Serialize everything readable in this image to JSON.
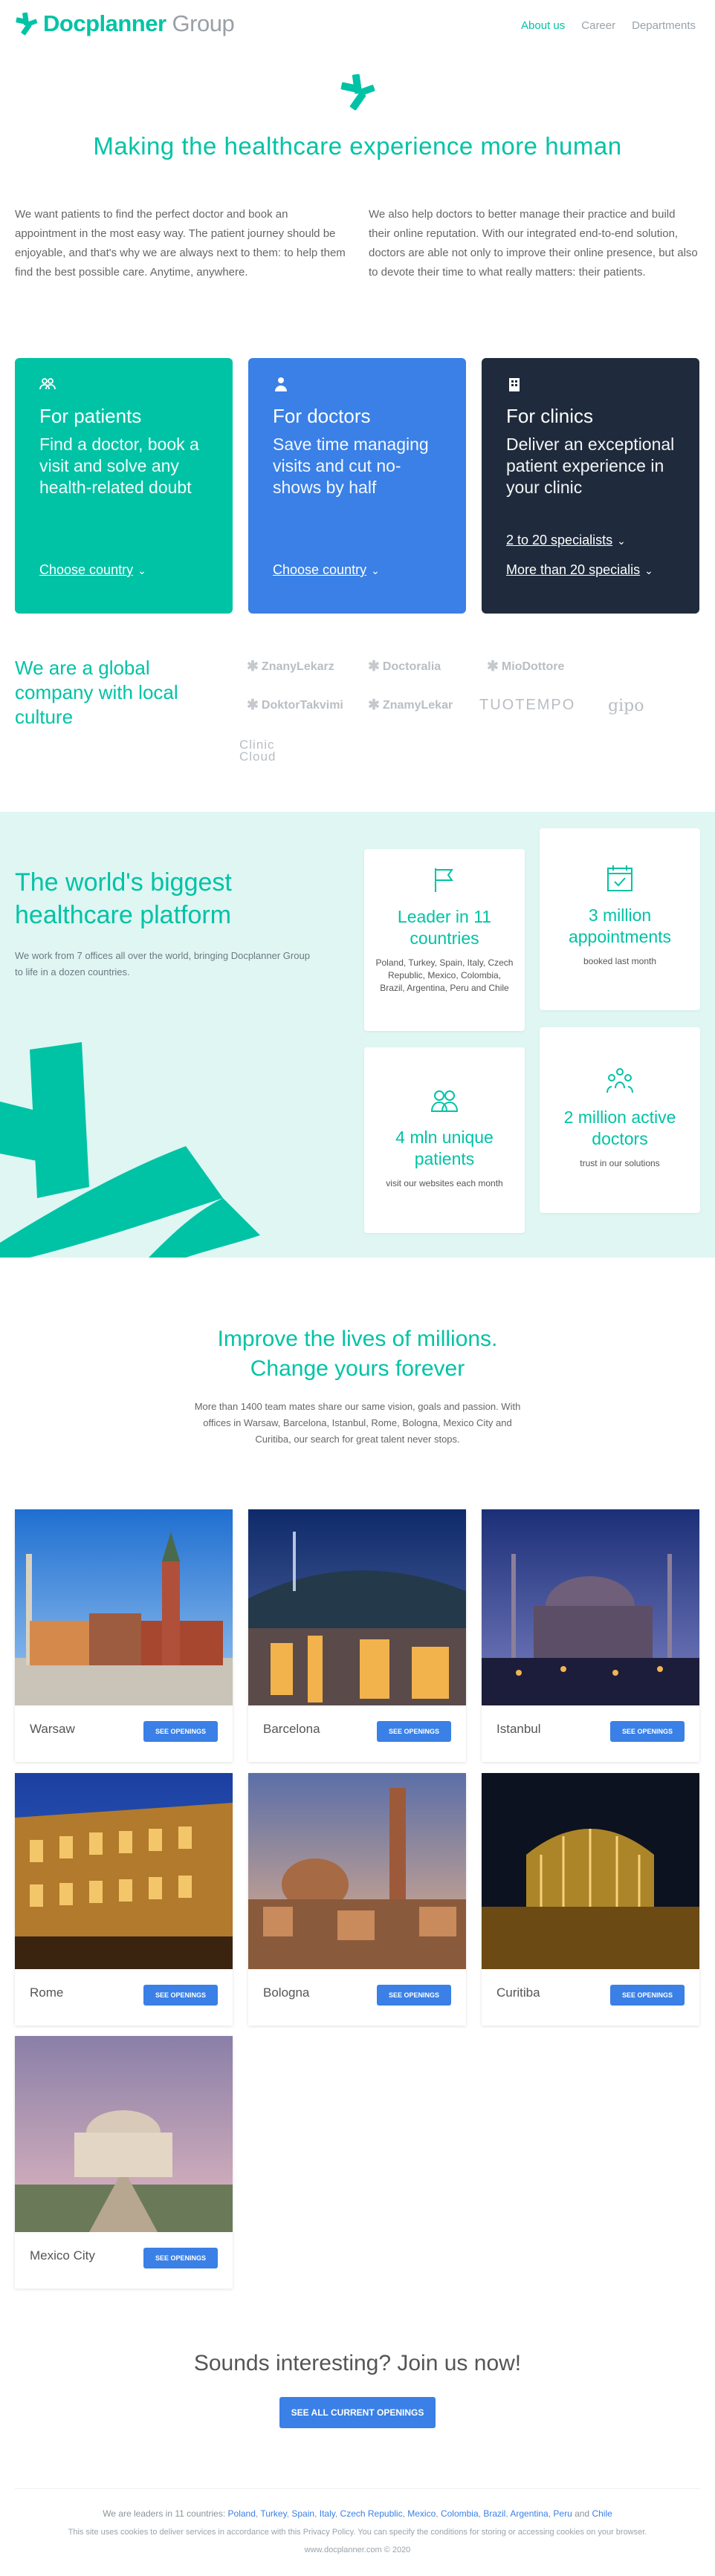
{
  "header": {
    "logo_word1": "Docplanner",
    "logo_word2": "Group",
    "nav": [
      "About us",
      "Career",
      "Departments"
    ]
  },
  "hero": {
    "title": "Making the healthcare experience more human",
    "intro_left": "We want patients to find the perfect doctor and book an appointment in the most easy way. The patient journey should be enjoyable, and that's why we are always next to them: to help them find the best possible care. Anytime, anywhere.",
    "intro_right": "We also help doctors to better manage their practice and build their online reputation. With our integrated end-to-end solution, doctors are able not only to improve their online presence, but also to devote their time to what really matters: their patients."
  },
  "cards": [
    {
      "title": "For patients",
      "text": "Find a doctor, book a visit and solve any health-related doubt",
      "links": [
        "Choose country"
      ],
      "color": "#00c3a5",
      "icon": "people-icon"
    },
    {
      "title": "For doctors",
      "text": "Save time managing visits and cut no-shows by half",
      "links": [
        "Choose country"
      ],
      "color": "#3a80e6",
      "icon": "doctor-icon"
    },
    {
      "title": "For clinics",
      "text": "Deliver an exceptional patient experience in your clinic",
      "links": [
        "2 to 20 specialists",
        "More than 20 specialis"
      ],
      "color": "#1f2b3c",
      "icon": "building-icon"
    }
  ],
  "global": {
    "heading": "We are a global company with local culture",
    "brands": [
      "ZnanyLekarz",
      "Doctoralia",
      "MioDottore",
      "DoktorTakvimi",
      "ZnamyLekar",
      "TUOTEMPO",
      "gipo",
      "Clinic Cloud"
    ]
  },
  "platform": {
    "title": "The world's biggest healthcare platform",
    "subtitle": "We work from 7 offices all over the world, bringing Docplanner Group to life in a dozen countries.",
    "stats": [
      {
        "big": "Leader in 11 countries",
        "small": "Poland, Turkey, Spain, Italy, Czech Republic, Mexico, Colombia, Brazil, Argentina, Peru and Chile",
        "icon": "flag-icon"
      },
      {
        "big": "3 million appointments",
        "small": "booked last month",
        "icon": "calendar-icon"
      },
      {
        "big": "4 mln unique patients",
        "small": "visit our websites each month",
        "icon": "patients-icon"
      },
      {
        "big": "2 million active doctors",
        "small": "trust in our solutions",
        "icon": "doctors-icon"
      }
    ]
  },
  "careers": {
    "title_line1": "Improve the lives of millions.",
    "title_line2": "Change yours forever",
    "subtitle": "More than 1400 team mates share our same vision, goals and passion. With offices in Warsaw, Barcelona, Istanbul, Rome, Bologna, Mexico City and Curitiba, our search for great talent never stops.",
    "button_label": "SEE OPENINGS",
    "offices": [
      "Warsaw",
      "Barcelona",
      "Istanbul",
      "Rome",
      "Bologna",
      "Curitiba",
      "Mexico City"
    ]
  },
  "join": {
    "title": "Sounds interesting? Join us now!",
    "button": "SEE ALL CURRENT OPENINGS"
  },
  "footer": {
    "leaders_prefix": "We are leaders in 11 countries:",
    "countries": [
      "Poland",
      "Turkey",
      "Spain",
      "Italy",
      "Czech Republic",
      "Mexico",
      "Colombia",
      "Brazil",
      "Argentina",
      "Peru",
      "Chile"
    ],
    "cookies": "This site uses cookies to deliver services in accordance with this Privacy Policy. You can specify the conditions for storing or accessing cookies on your browser.",
    "copyright": "www.docplanner.com © 2020"
  }
}
